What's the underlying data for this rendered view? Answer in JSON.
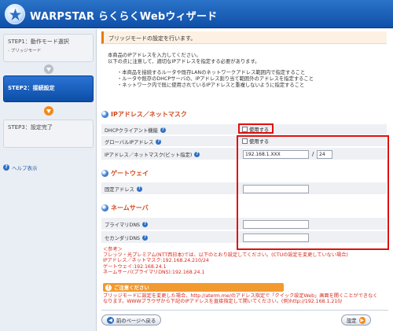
{
  "header": {
    "title": "WARPSTAR らくらくWebウィザード"
  },
  "sidebar": {
    "steps": [
      {
        "label": "STEP1：動作モード選択",
        "sub": "- ブリッジモード"
      },
      {
        "label": "STEP2：接続設定"
      },
      {
        "label": "STEP3：設定完了"
      }
    ],
    "help": "ヘルプ表示"
  },
  "main": {
    "page_title": "ブリッジモードの設定を行います。",
    "intro": [
      "本商品のIPアドレスを入力してください。",
      "以下の点に注意して、適切なIPアドレスを指定する必要があります。"
    ],
    "bullets": [
      "・本商品を接続するルータや既存LANのネットワークアドレス範囲内で指定すること",
      "・ルータや既存のDHCPサーバの、IPアドレス割り当て範囲外のアドレスを指定すること",
      "・ネットワーク内で既に使用されているIPアドレスと重複しないように指定すること"
    ],
    "ip_section": {
      "heading": "IPアドレス／ネットマスク",
      "dhcp_label": "DHCPクライアント機能",
      "dhcp_checkbox": "使用する",
      "global_label": "グローバルIPアドレス",
      "global_checkbox": "使用する",
      "ip_label": "IPアドレス／ネットマスク(ビット指定)",
      "ip_value": "192.168.1.XXX",
      "separator": "/",
      "mask_value": "24"
    },
    "gateway_section": {
      "heading": "ゲートウェイ",
      "fixed_label": "固定アドレス",
      "fixed_value": ""
    },
    "dns_section": {
      "heading": "ネームサーバ",
      "primary_label": "プライマリDNS",
      "primary_value": "",
      "secondary_label": "セカンダリDNS",
      "secondary_value": ""
    },
    "notes": [
      "＜参考＞",
      "フレッツ・光プレミアム(NTT西日本)では、以下のとおり設定してください。(CTUの設定を変更していない場合)",
      "IPアドレス／ネットマスク:192.168.24.210/24",
      "ゲートウェイ:192.168.24.1",
      "ネームサーバ(プライマリDNS):192.168.24.1"
    ],
    "caution_title": "ご注意ください",
    "caution_lines": [
      "ブリッジモードに設定を変更した場合、http://aterm.me/のアドレス指定で「クイック設定Web」画面を開くことができなく",
      "なります。WWWブラウザから下記のIPアドレスを直接指定して開いてください。(例)http://192.168.1.210/"
    ],
    "back_button": "前のページへ戻る",
    "set_button": "設定"
  }
}
